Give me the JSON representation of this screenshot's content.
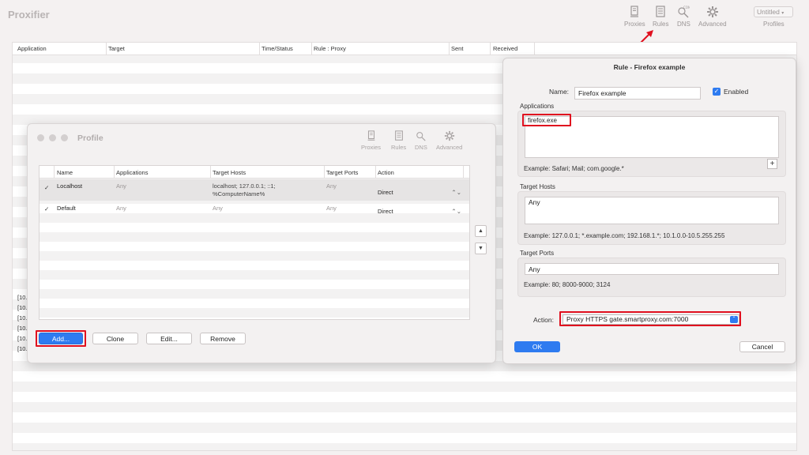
{
  "main_window": {
    "title": "Proxifier",
    "toolbar": [
      {
        "label": "Proxies",
        "icon": "proxies-icon"
      },
      {
        "label": "Rules",
        "icon": "rules-icon"
      },
      {
        "label": "DNS",
        "icon": "dns-icon"
      },
      {
        "label": "Advanced",
        "icon": "gear-icon"
      }
    ],
    "profile_select": "Untitled",
    "profiles_label": "Profiles",
    "table_headers": [
      "Application",
      "Target",
      "Time/Status",
      "Rule : Proxy",
      "Sent",
      "Received"
    ],
    "log_lines": [
      "[10.",
      "[10.",
      "[10.",
      "[10.",
      "[10.",
      "[10."
    ],
    "annotation_color": "#e0101f"
  },
  "profile_window": {
    "title": "Profile",
    "toolbar": [
      {
        "label": "Proxies",
        "icon": "proxies-icon"
      },
      {
        "label": "Rules",
        "icon": "rules-icon"
      },
      {
        "label": "DNS",
        "icon": "dns-icon"
      },
      {
        "label": "Advanced",
        "icon": "gear-icon"
      }
    ],
    "table_headers": [
      "Name",
      "Applications",
      "Target Hosts",
      "Target Ports",
      "Action"
    ],
    "rules": [
      {
        "checked": "✓",
        "name": "Localhost",
        "applications": "Any",
        "target_hosts_line1": "localhost; 127.0.0.1; ::1;",
        "target_hosts_line2": "%ComputerName%",
        "target_ports": "Any",
        "action": "Direct"
      },
      {
        "checked": "✓",
        "name": "Default",
        "applications": "Any",
        "target_hosts_line1": "Any",
        "target_hosts_line2": "",
        "target_ports": "Any",
        "action": "Direct"
      }
    ],
    "buttons": {
      "add": "Add...",
      "clone": "Clone",
      "edit": "Edit...",
      "remove": "Remove"
    },
    "move_up": "▲",
    "move_down": "▼"
  },
  "rule_window": {
    "title": "Rule - Firefox example",
    "name_label": "Name:",
    "name_value": "Firefox example",
    "enabled_label": "Enabled",
    "enabled_check": "✓",
    "applications_label": "Applications",
    "applications_value": "firefox.exe",
    "applications_example": "Example: Safari; Mail; com.google.*",
    "plus": "+",
    "target_hosts_label": "Target Hosts",
    "target_hosts_value": "Any",
    "target_hosts_example": "Example: 127.0.0.1; *.example.com; 192.168.1.*; 10.1.0.0-10.5.255.255",
    "target_ports_label": "Target Ports",
    "target_ports_value": "Any",
    "target_ports_example": "Example: 80; 8000-9000; 3124",
    "action_label": "Action:",
    "action_value": "Proxy HTTPS gate.smartproxy.com:7000",
    "ok": "OK",
    "cancel": "Cancel",
    "accent_color": "#2e7bf0"
  }
}
